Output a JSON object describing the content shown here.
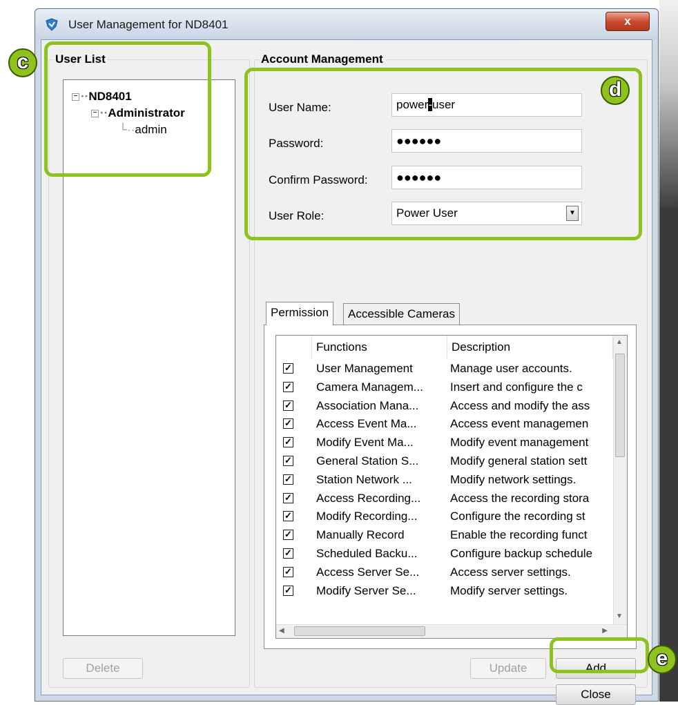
{
  "window": {
    "title": "User Management for ND8401",
    "close_glyph": "x"
  },
  "user_list": {
    "title": "User List",
    "root": "ND8401",
    "group": "Administrator",
    "user": "admin",
    "delete_label": "Delete"
  },
  "account": {
    "title": "Account Management",
    "username_label": "User Name:",
    "username_before": "power",
    "username_caret": "-",
    "username_after": "user",
    "password_label": "Password:",
    "password_value": "●●●●●●",
    "confirm_label": "Confirm Password:",
    "confirm_value": "●●●●●●",
    "role_label": "User Role:",
    "role_value": "Power User"
  },
  "tabs": {
    "permission": "Permission",
    "cameras": "Accessible Cameras"
  },
  "permissions": {
    "col_functions": "Functions",
    "col_description": "Description",
    "rows": [
      {
        "fn": "User Management",
        "desc": "Manage user accounts."
      },
      {
        "fn": "Camera Managem...",
        "desc": "Insert and configure the c"
      },
      {
        "fn": "Association Mana...",
        "desc": "Access and modify the ass"
      },
      {
        "fn": "Access Event Ma...",
        "desc": "Access event managemen"
      },
      {
        "fn": "Modify Event Ma...",
        "desc": "Modify event management"
      },
      {
        "fn": "General Station S...",
        "desc": "Modify general station sett"
      },
      {
        "fn": "Station Network ...",
        "desc": "Modify network settings."
      },
      {
        "fn": "Access Recording...",
        "desc": "Access the recording stora"
      },
      {
        "fn": "Modify Recording...",
        "desc": "Configure the recording st"
      },
      {
        "fn": "Manually Record",
        "desc": "Enable the recording funct"
      },
      {
        "fn": "Scheduled Backu...",
        "desc": "Configure backup schedule"
      },
      {
        "fn": "Access Server Se...",
        "desc": "Access server settings."
      },
      {
        "fn": "Modify Server Se...",
        "desc": "Modify server settings."
      }
    ]
  },
  "buttons": {
    "update": "Update",
    "add": "Add",
    "close": "Close"
  },
  "callouts": {
    "c": "c",
    "d": "d",
    "e": "e"
  },
  "colors": {
    "highlight": "#8dc21f"
  }
}
